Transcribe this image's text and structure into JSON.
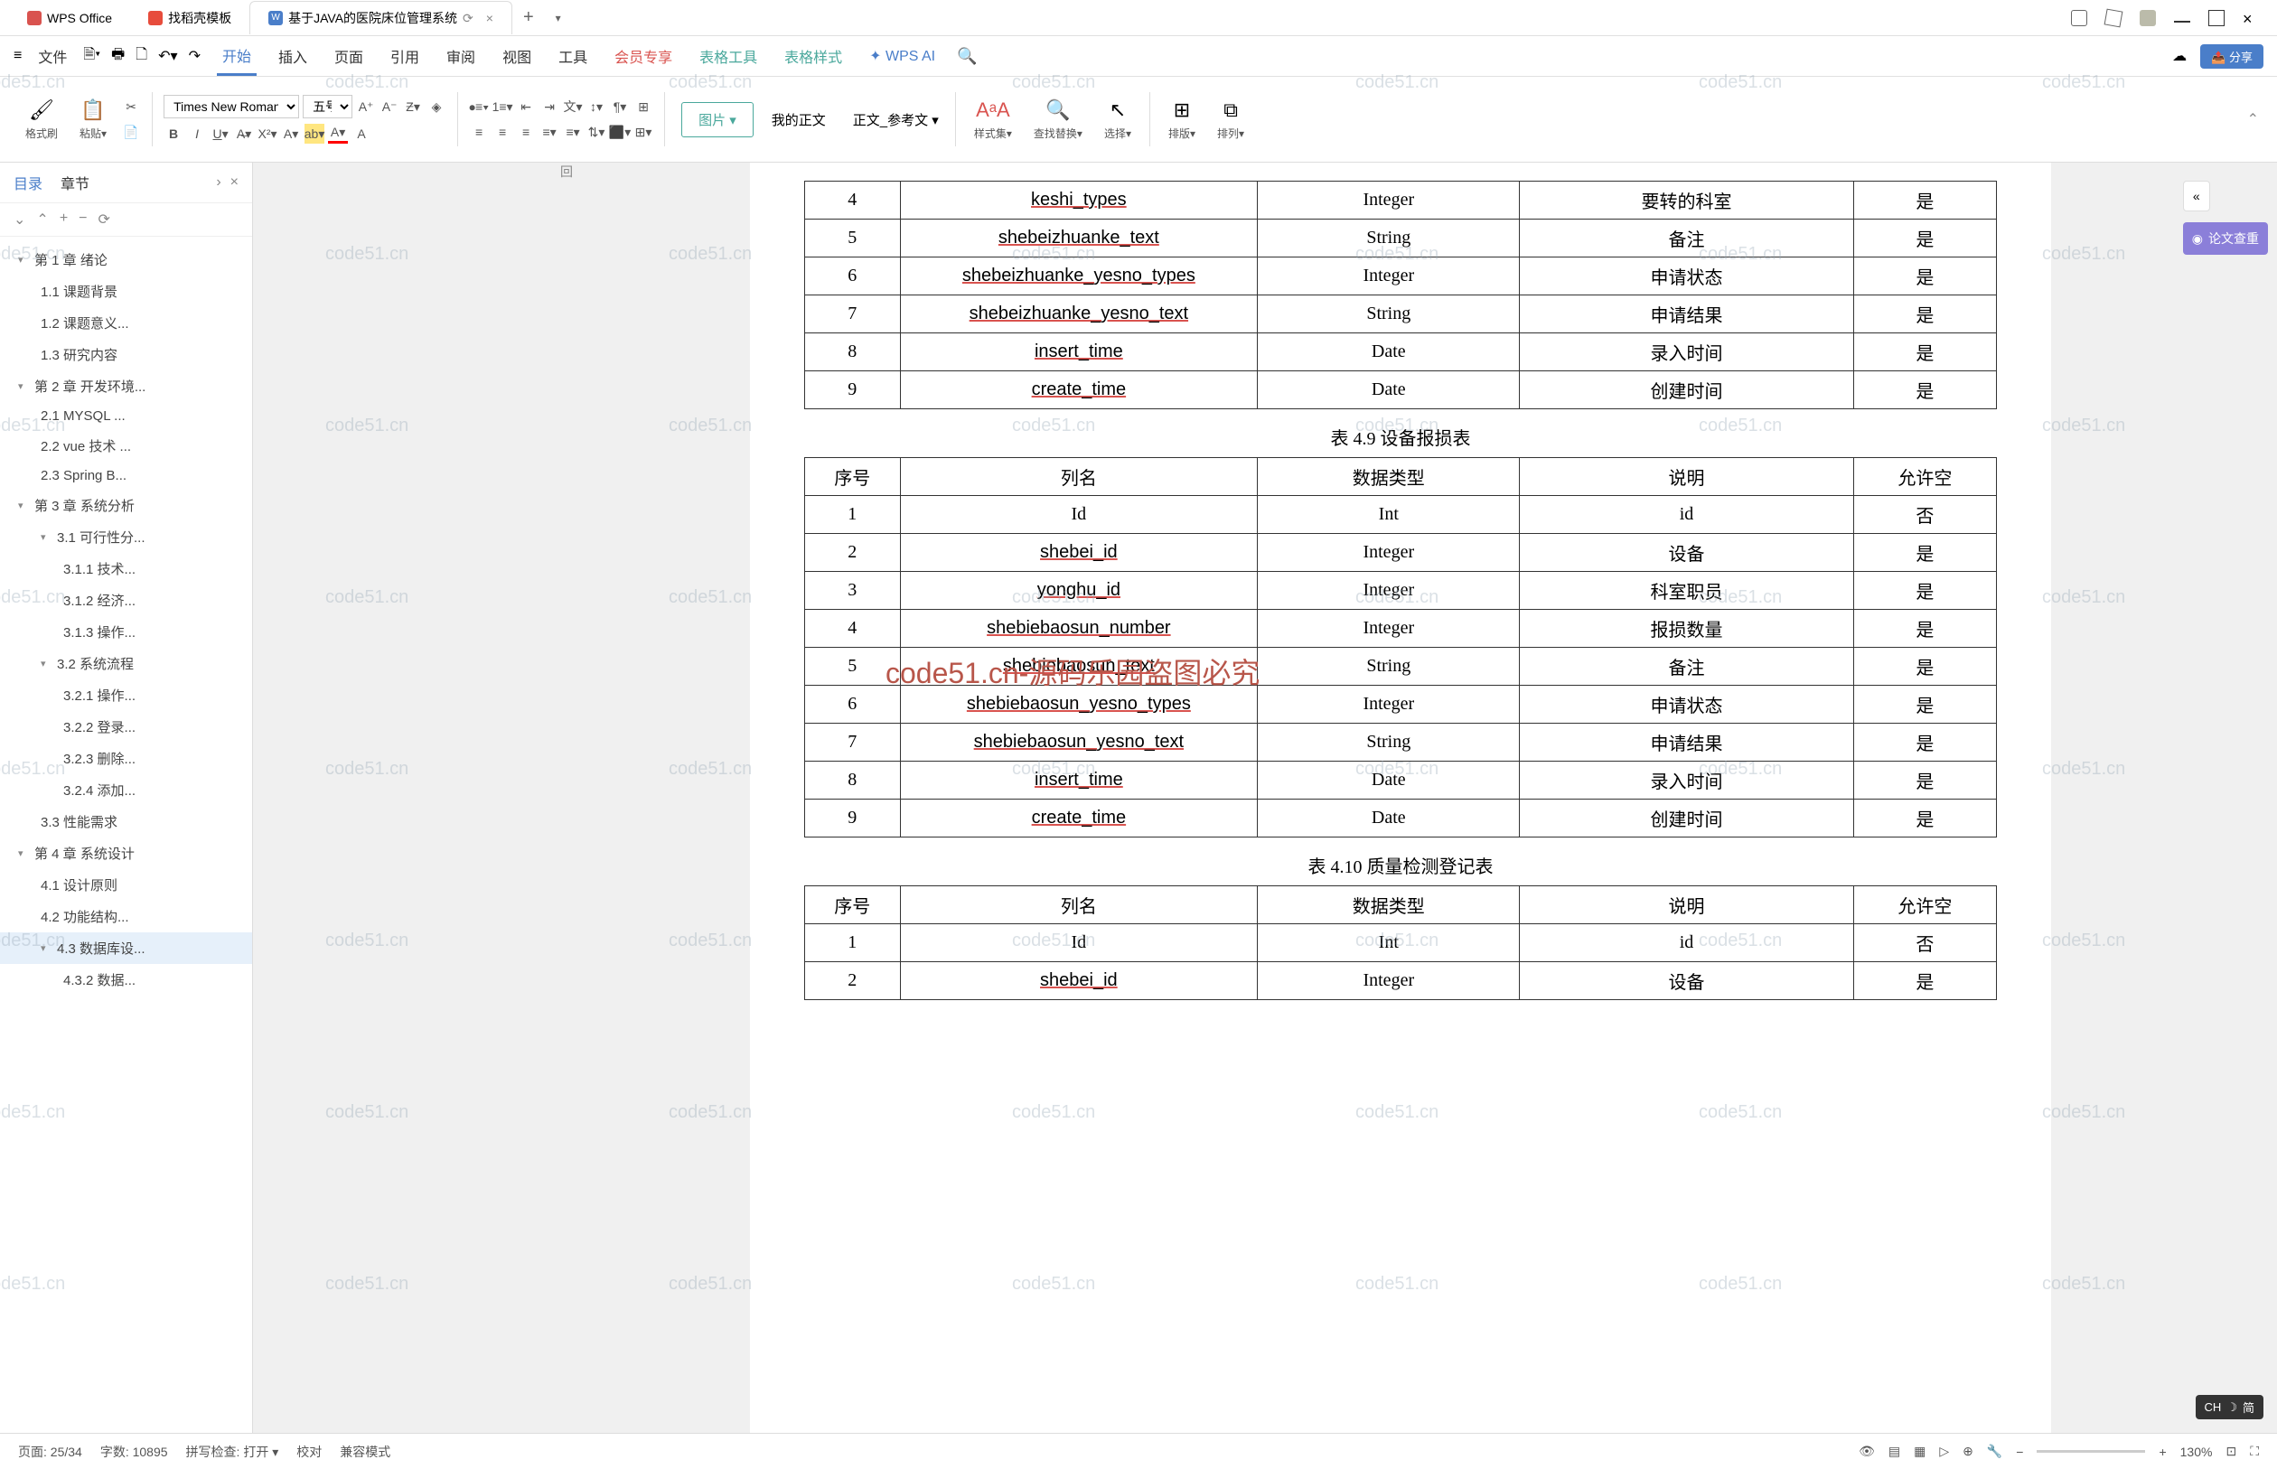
{
  "titleBar": {
    "tab1": "WPS Office",
    "tab2": "找稻壳模板",
    "tab3": "基于JAVA的医院床位管理系统",
    "tab3Icon": "W"
  },
  "menus": {
    "file": "文件",
    "start": "开始",
    "insert": "插入",
    "page": "页面",
    "ref": "引用",
    "review": "审阅",
    "view": "视图",
    "tools": "工具",
    "member": "会员专享",
    "tabletools": "表格工具",
    "tablestyle": "表格样式",
    "wpsai": "WPS AI",
    "share": "分享"
  },
  "ribbon": {
    "formatBrush": "格式刷",
    "paste": "粘贴",
    "font": "Times New Roman",
    "fontSize": "五号",
    "image": "图片",
    "myText": "我的正文",
    "refText": "正文_参考文",
    "style": "样式集",
    "findReplace": "查找替换",
    "select": "选择",
    "arrange": "排版",
    "order": "排列"
  },
  "sidebar": {
    "tab1": "目录",
    "tab2": "章节",
    "items": [
      {
        "lvl": 1,
        "txt": "第 1 章  绪论",
        "arrow": true
      },
      {
        "lvl": 2,
        "txt": "1.1  课题背景"
      },
      {
        "lvl": 2,
        "txt": "1.2  课题意义..."
      },
      {
        "lvl": 2,
        "txt": "1.3  研究内容"
      },
      {
        "lvl": 1,
        "txt": "第 2 章  开发环境...",
        "arrow": true
      },
      {
        "lvl": 2,
        "txt": "2.1 MYSQL ..."
      },
      {
        "lvl": 2,
        "txt": "2.2 vue 技术 ..."
      },
      {
        "lvl": 2,
        "txt": "2.3 Spring B..."
      },
      {
        "lvl": 1,
        "txt": "第 3 章  系统分析",
        "arrow": true
      },
      {
        "lvl": 2,
        "txt": "3.1  可行性分...",
        "arrow": true
      },
      {
        "lvl": 3,
        "txt": "3.1.1  技术..."
      },
      {
        "lvl": 3,
        "txt": "3.1.2  经济..."
      },
      {
        "lvl": 3,
        "txt": "3.1.3  操作..."
      },
      {
        "lvl": 2,
        "txt": "3.2  系统流程",
        "arrow": true
      },
      {
        "lvl": 3,
        "txt": "3.2.1  操作..."
      },
      {
        "lvl": 3,
        "txt": "3.2.2  登录..."
      },
      {
        "lvl": 3,
        "txt": "3.2.3  删除..."
      },
      {
        "lvl": 3,
        "txt": "3.2.4  添加..."
      },
      {
        "lvl": 2,
        "txt": "3.3  性能需求"
      },
      {
        "lvl": 1,
        "txt": "第 4 章  系统设计",
        "arrow": true
      },
      {
        "lvl": 2,
        "txt": "4.1  设计原则"
      },
      {
        "lvl": 2,
        "txt": "4.2  功能结构..."
      },
      {
        "lvl": 2,
        "txt": "4.3  数据库设...",
        "arrow": true,
        "sel": true
      },
      {
        "lvl": 3,
        "txt": "4.3.2  数据..."
      }
    ]
  },
  "doc": {
    "table1": {
      "rows": [
        [
          "4",
          "keshi_types",
          "Integer",
          "要转的科室",
          "是"
        ],
        [
          "5",
          "shebeizhuanke_text",
          "String",
          "备注",
          "是"
        ],
        [
          "6",
          "shebeizhuanke_yesno_types",
          "Integer",
          "申请状态",
          "是"
        ],
        [
          "7",
          "shebeizhuanke_yesno_text",
          "String",
          "申请结果",
          "是"
        ],
        [
          "8",
          "insert_time",
          "Date",
          "录入时间",
          "是"
        ],
        [
          "9",
          "create_time",
          "Date",
          "创建时间",
          "是"
        ]
      ]
    },
    "caption1": "表 4.9 设备报损表",
    "table2": {
      "header": [
        "序号",
        "列名",
        "数据类型",
        "说明",
        "允许空"
      ],
      "rows": [
        [
          "1",
          "Id",
          "Int",
          "id",
          "否"
        ],
        [
          "2",
          "shebei_id",
          "Integer",
          "设备",
          "是"
        ],
        [
          "3",
          "yonghu_id",
          "Integer",
          "科室职员",
          "是"
        ],
        [
          "4",
          "shebiebaosun_number",
          "Integer",
          "报损数量",
          "是"
        ],
        [
          "5",
          "shebiebaosun_text",
          "String",
          "备注",
          "是"
        ],
        [
          "6",
          "shebiebaosun_yesno_types",
          "Integer",
          "申请状态",
          "是"
        ],
        [
          "7",
          "shebiebaosun_yesno_text",
          "String",
          "申请结果",
          "是"
        ],
        [
          "8",
          "insert_time",
          "Date",
          "录入时间",
          "是"
        ],
        [
          "9",
          "create_time",
          "Date",
          "创建时间",
          "是"
        ]
      ]
    },
    "caption2": "表 4.10 质量检测登记表",
    "table3": {
      "header": [
        "序号",
        "列名",
        "数据类型",
        "说明",
        "允许空"
      ],
      "rows": [
        [
          "1",
          "Id",
          "Int",
          "id",
          "否"
        ],
        [
          "2",
          "shebei_id",
          "Integer",
          "设备",
          "是"
        ]
      ]
    },
    "watermarkText": "code51.cn",
    "wmRed": "code51.cn-源码乐园盗图必究",
    "rulerMark": "回"
  },
  "rightBar": {
    "collapse": "«",
    "thesis": "论文查重"
  },
  "statusBar": {
    "page": "页面: 25/34",
    "words": "字数: 10895",
    "spell": "拼写检查: 打开",
    "proof": "校对",
    "compat": "兼容模式",
    "zoom": "130%",
    "lang": "CH",
    "langMode": "简"
  }
}
